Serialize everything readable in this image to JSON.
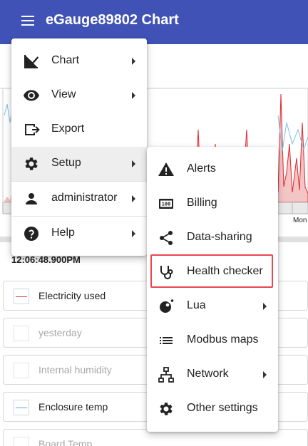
{
  "app": {
    "title": "eGauge89802 Chart"
  },
  "chart": {
    "axis_label_right": "Mon",
    "timestamp": "12:06:48.900PM"
  },
  "legend": [
    {
      "label": "Electricity used",
      "enabled": true,
      "color": "#d94a4a"
    },
    {
      "label": "yesterday",
      "enabled": false,
      "color": "#dddddd"
    },
    {
      "label": "Internal humidity",
      "enabled": false,
      "color": "#dddddd"
    },
    {
      "label": "Enclosure temp",
      "enabled": true,
      "color": "#6aa6d8"
    },
    {
      "label": "Board Temp",
      "enabled": false,
      "color": "#dddddd"
    }
  ],
  "main_menu": [
    {
      "label": "Chart",
      "icon": "chart-line-icon",
      "submenu": true
    },
    {
      "label": "View",
      "icon": "eye-icon",
      "submenu": true
    },
    {
      "label": "Export",
      "icon": "export-icon",
      "submenu": false
    },
    {
      "label": "Setup",
      "icon": "gear-icon",
      "submenu": true,
      "active": true
    },
    {
      "label": "administrator",
      "icon": "user-icon",
      "submenu": true
    },
    {
      "label": "Help",
      "icon": "help-icon",
      "submenu": true
    }
  ],
  "setup_menu": [
    {
      "label": "Alerts",
      "icon": "alert-icon",
      "submenu": false
    },
    {
      "label": "Billing",
      "icon": "billing-icon",
      "submenu": false
    },
    {
      "label": "Data-sharing",
      "icon": "share-icon",
      "submenu": false
    },
    {
      "label": "Health checker",
      "icon": "stethoscope-icon",
      "submenu": false,
      "highlighted": true
    },
    {
      "label": "Lua",
      "icon": "lua-icon",
      "submenu": true
    },
    {
      "label": "Modbus maps",
      "icon": "list-icon",
      "submenu": false
    },
    {
      "label": "Network",
      "icon": "network-icon",
      "submenu": true
    },
    {
      "label": "Other settings",
      "icon": "gear-icon",
      "submenu": false
    }
  ],
  "colors": {
    "appbar": "#4052b5",
    "highlight": "#e8474f",
    "chart_red": "#e0262e",
    "chart_blue": "#7cc0e6"
  }
}
